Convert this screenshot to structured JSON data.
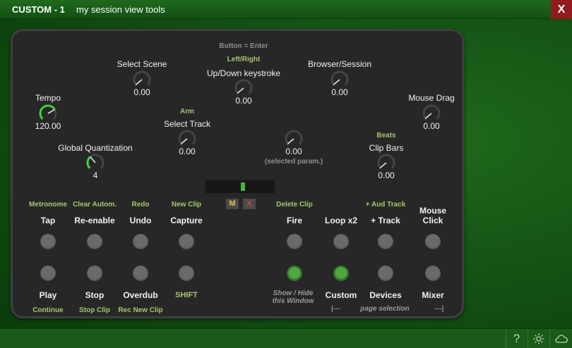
{
  "window": {
    "title": "CUSTOM - 1",
    "subtitle": "my session view tools",
    "close_label": "X"
  },
  "status_bar": {
    "icons": [
      "help-icon",
      "sun-icon",
      "cloud-icon"
    ],
    "help_label": "?"
  },
  "header_hint": "Button = Enter",
  "knobs": [
    {
      "name": "tempo",
      "label": "Tempo",
      "value": "120.00",
      "sublabel": ""
    },
    {
      "name": "select-scene",
      "label": "Select Scene",
      "value": "0.00",
      "sublabel": ""
    },
    {
      "name": "up-down-keystroke",
      "label": "Up/Down keystroke",
      "value": "0.00",
      "sublabel": "Left/Right"
    },
    {
      "name": "browser-session",
      "label": "Browser/Session",
      "value": "0.00",
      "sublabel": ""
    },
    {
      "name": "mouse-drag",
      "label": "Mouse Drag",
      "value": "0.00",
      "sublabel": ""
    },
    {
      "name": "select-track",
      "label": "Select Track",
      "value": "0.00",
      "sublabel": "Arm"
    },
    {
      "name": "selected-param",
      "label": "",
      "value": "0.00",
      "sublabel": "(selected param.)"
    },
    {
      "name": "clip-bars",
      "label": "Clip Bars",
      "value": "0.00",
      "sublabel": "Beats"
    },
    {
      "name": "global-quantization",
      "label": "Global Quantization",
      "value": "4",
      "sublabel": ""
    }
  ],
  "meter": {
    "level": 0.52
  },
  "mini_buttons": {
    "m": "M",
    "x": "X"
  },
  "left_top": [
    {
      "name": "tap",
      "label": "Tap",
      "alt": "Metronome"
    },
    {
      "name": "re-enable",
      "label": "Re-enable",
      "alt": "Clear Autom."
    },
    {
      "name": "undo",
      "label": "Undo",
      "alt": "Redo"
    },
    {
      "name": "capture",
      "label": "Capture",
      "alt": "New Clip"
    }
  ],
  "right_top": [
    {
      "name": "fire",
      "label": "Fire",
      "alt": "Delete Clip"
    },
    {
      "name": "loop-x2",
      "label": "Loop x2",
      "alt": ""
    },
    {
      "name": "add-track",
      "label": "+ Track",
      "alt": "+ Aud Track"
    },
    {
      "name": "mouse-click",
      "label": "Mouse\nClick",
      "alt": ""
    }
  ],
  "left_bottom": [
    {
      "name": "play",
      "label": "Play",
      "alt": "Continue"
    },
    {
      "name": "stop",
      "label": "Stop",
      "alt": "Stop Clip"
    },
    {
      "name": "overdub",
      "label": "Overdub",
      "alt": "Rec New Clip"
    },
    {
      "name": "shift",
      "label": "SHIFT",
      "alt": ""
    }
  ],
  "right_bottom": [
    {
      "name": "show-hide",
      "label": "",
      "note": "Show / Hide\nthis Window",
      "on": true
    },
    {
      "name": "custom",
      "label": "Custom",
      "note": "|---",
      "on": true
    },
    {
      "name": "devices",
      "label": "Devices",
      "note": "page selection",
      "on": false
    },
    {
      "name": "mixer",
      "label": "Mixer",
      "note": "---|",
      "on": false
    }
  ],
  "colors": {
    "accent_green": "#a4c76f",
    "knob_arc": "#3fd13c",
    "panel_bg": "#272727",
    "close_red": "#8f1d1d"
  }
}
